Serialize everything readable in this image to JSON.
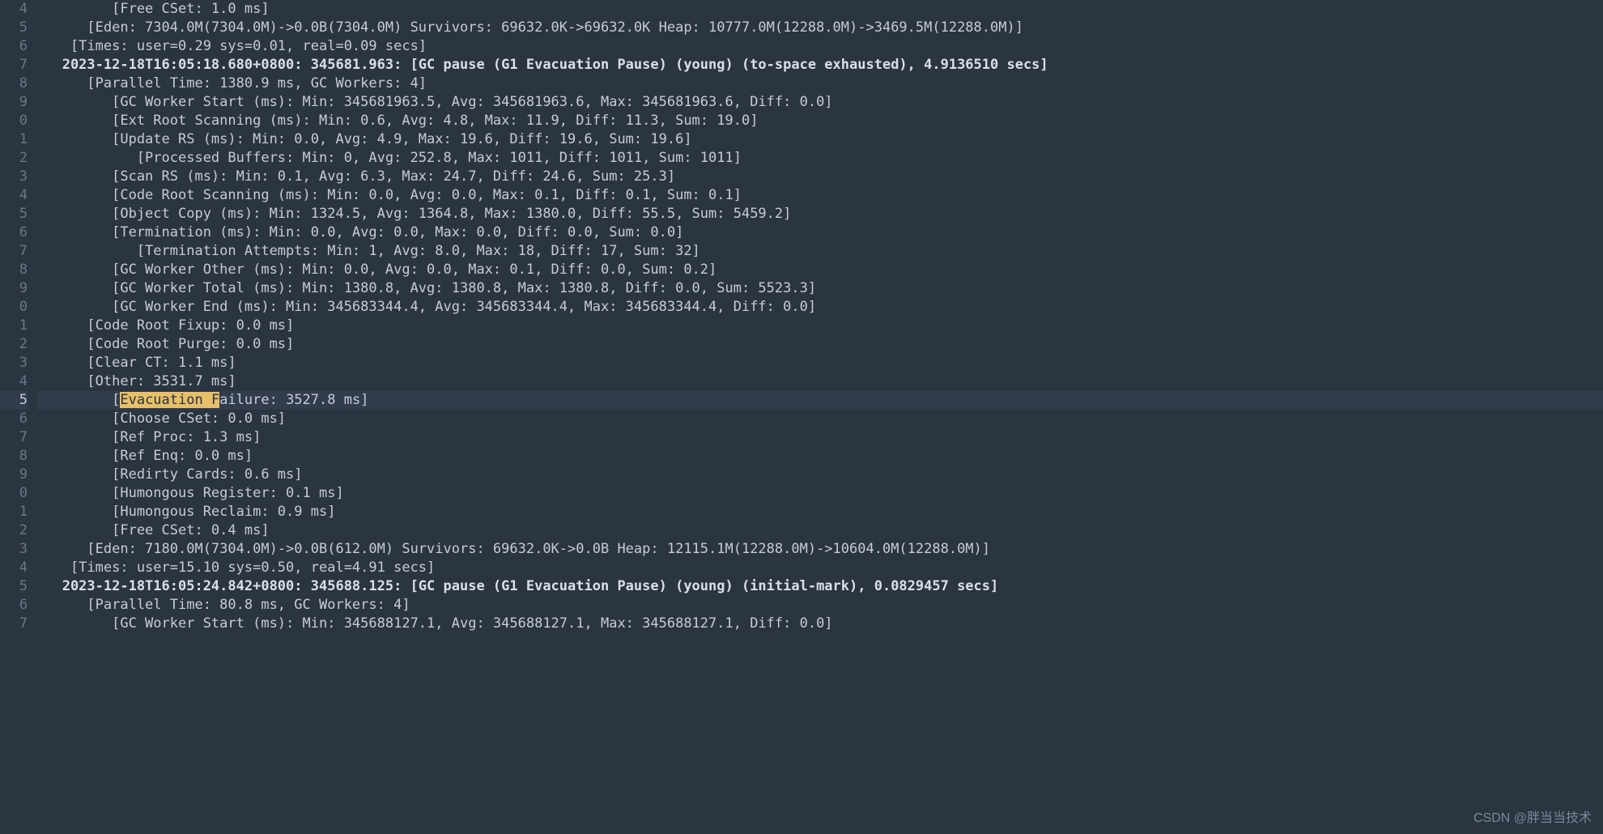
{
  "watermark": "CSDN @胖当当技术",
  "highlight": "Evacuation F",
  "currentLine": 21,
  "lines": [
    {
      "num": "4",
      "indent": 9,
      "text": "[Free CSet: 1.0 ms]"
    },
    {
      "num": "5",
      "indent": 6,
      "text": "[Eden: 7304.0M(7304.0M)->0.0B(7304.0M) Survivors: 69632.0K->69632.0K Heap: 10777.0M(12288.0M)->3469.5M(12288.0M)]"
    },
    {
      "num": "6",
      "indent": 4,
      "text": "[Times: user=0.29 sys=0.01, real=0.09 secs]"
    },
    {
      "num": "7",
      "indent": 3,
      "bold": true,
      "text": "2023-12-18T16:05:18.680+0800: 345681.963: [GC pause (G1 Evacuation Pause) (young) (to-space exhausted), 4.9136510 secs]"
    },
    {
      "num": "8",
      "indent": 6,
      "text": "[Parallel Time: 1380.9 ms, GC Workers: 4]"
    },
    {
      "num": "9",
      "indent": 9,
      "text": "[GC Worker Start (ms): Min: 345681963.5, Avg: 345681963.6, Max: 345681963.6, Diff: 0.0]"
    },
    {
      "num": "0",
      "indent": 9,
      "text": "[Ext Root Scanning (ms): Min: 0.6, Avg: 4.8, Max: 11.9, Diff: 11.3, Sum: 19.0]"
    },
    {
      "num": "1",
      "indent": 9,
      "text": "[Update RS (ms): Min: 0.0, Avg: 4.9, Max: 19.6, Diff: 19.6, Sum: 19.6]"
    },
    {
      "num": "2",
      "indent": 12,
      "text": "[Processed Buffers: Min: 0, Avg: 252.8, Max: 1011, Diff: 1011, Sum: 1011]"
    },
    {
      "num": "3",
      "indent": 9,
      "text": "[Scan RS (ms): Min: 0.1, Avg: 6.3, Max: 24.7, Diff: 24.6, Sum: 25.3]"
    },
    {
      "num": "4",
      "indent": 9,
      "text": "[Code Root Scanning (ms): Min: 0.0, Avg: 0.0, Max: 0.1, Diff: 0.1, Sum: 0.1]"
    },
    {
      "num": "5",
      "indent": 9,
      "text": "[Object Copy (ms): Min: 1324.5, Avg: 1364.8, Max: 1380.0, Diff: 55.5, Sum: 5459.2]"
    },
    {
      "num": "6",
      "indent": 9,
      "text": "[Termination (ms): Min: 0.0, Avg: 0.0, Max: 0.0, Diff: 0.0, Sum: 0.0]"
    },
    {
      "num": "7",
      "indent": 12,
      "text": "[Termination Attempts: Min: 1, Avg: 8.0, Max: 18, Diff: 17, Sum: 32]"
    },
    {
      "num": "8",
      "indent": 9,
      "text": "[GC Worker Other (ms): Min: 0.0, Avg: 0.0, Max: 0.1, Diff: 0.0, Sum: 0.2]"
    },
    {
      "num": "9",
      "indent": 9,
      "text": "[GC Worker Total (ms): Min: 1380.8, Avg: 1380.8, Max: 1380.8, Diff: 0.0, Sum: 5523.3]"
    },
    {
      "num": "0",
      "indent": 9,
      "text": "[GC Worker End (ms): Min: 345683344.4, Avg: 345683344.4, Max: 345683344.4, Diff: 0.0]"
    },
    {
      "num": "1",
      "indent": 6,
      "text": "[Code Root Fixup: 0.0 ms]"
    },
    {
      "num": "2",
      "indent": 6,
      "text": "[Code Root Purge: 0.0 ms]"
    },
    {
      "num": "3",
      "indent": 6,
      "text": "[Clear CT: 1.1 ms]"
    },
    {
      "num": "4",
      "indent": 6,
      "text": "[Other: 3531.7 ms]"
    },
    {
      "num": "5",
      "indent": 9,
      "text": "[Evacuation Failure: 3527.8 ms]",
      "highlightAt": 1
    },
    {
      "num": "6",
      "indent": 9,
      "text": "[Choose CSet: 0.0 ms]"
    },
    {
      "num": "7",
      "indent": 9,
      "text": "[Ref Proc: 1.3 ms]"
    },
    {
      "num": "8",
      "indent": 9,
      "text": "[Ref Enq: 0.0 ms]"
    },
    {
      "num": "9",
      "indent": 9,
      "text": "[Redirty Cards: 0.6 ms]"
    },
    {
      "num": "0",
      "indent": 9,
      "text": "[Humongous Register: 0.1 ms]"
    },
    {
      "num": "1",
      "indent": 9,
      "text": "[Humongous Reclaim: 0.9 ms]"
    },
    {
      "num": "2",
      "indent": 9,
      "text": "[Free CSet: 0.4 ms]"
    },
    {
      "num": "3",
      "indent": 6,
      "text": "[Eden: 7180.0M(7304.0M)->0.0B(612.0M) Survivors: 69632.0K->0.0B Heap: 12115.1M(12288.0M)->10604.0M(12288.0M)]"
    },
    {
      "num": "4",
      "indent": 4,
      "text": "[Times: user=15.10 sys=0.50, real=4.91 secs]"
    },
    {
      "num": "5",
      "indent": 3,
      "bold": true,
      "text": "2023-12-18T16:05:24.842+0800: 345688.125: [GC pause (G1 Evacuation Pause) (young) (initial-mark), 0.0829457 secs]"
    },
    {
      "num": "6",
      "indent": 6,
      "text": "[Parallel Time: 80.8 ms, GC Workers: 4]"
    },
    {
      "num": "7",
      "indent": 9,
      "text": "[GC Worker Start (ms): Min: 345688127.1, Avg: 345688127.1, Max: 345688127.1, Diff: 0.0]"
    }
  ]
}
